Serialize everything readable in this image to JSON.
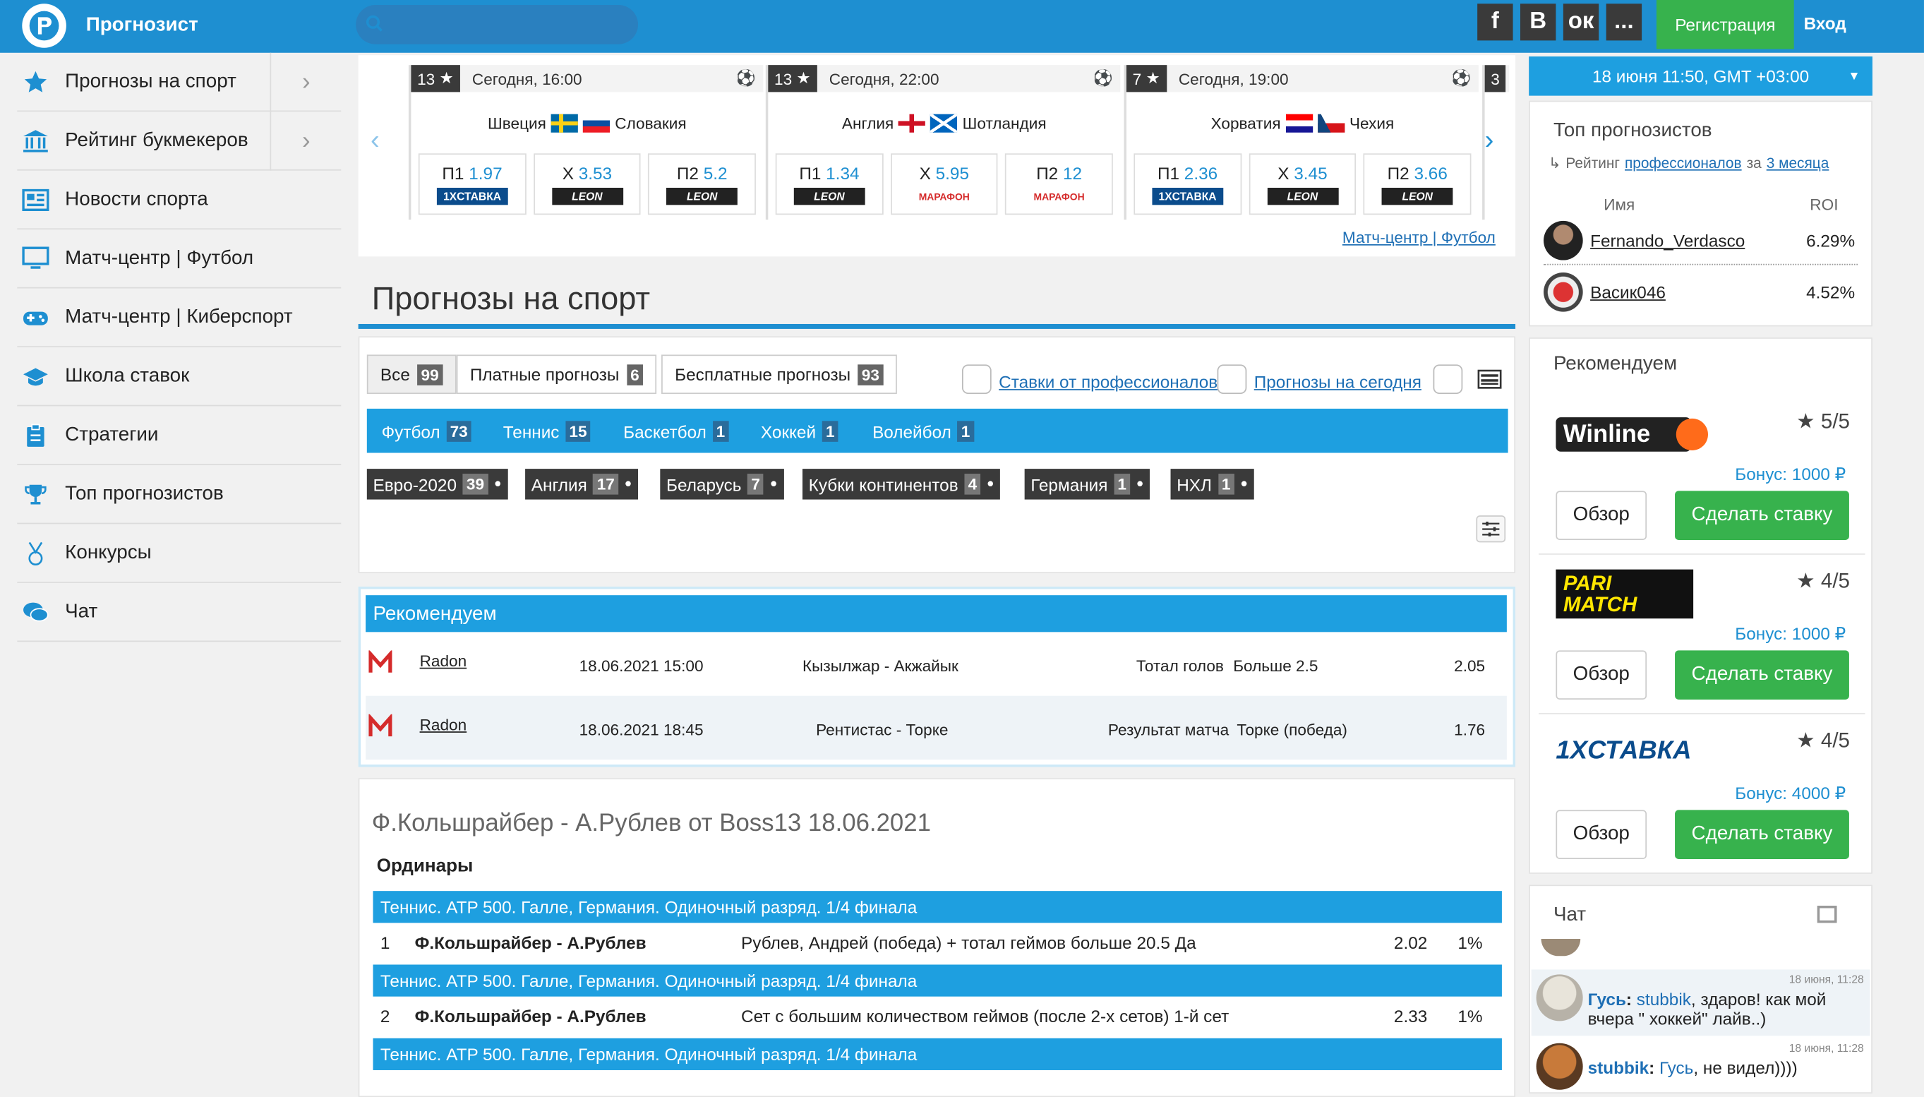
{
  "header": {
    "logo_text": "Прогнозист",
    "search_placeholder": "",
    "social": [
      "f",
      "B",
      "ок",
      "..."
    ],
    "register": "Регистрация",
    "login": "Вход"
  },
  "sidebar": {
    "items": [
      {
        "label": "Прогнозы на спорт",
        "icon": "star-icon",
        "has_chevron": true
      },
      {
        "label": "Рейтинг букмекеров",
        "icon": "bank-icon",
        "has_chevron": true
      },
      {
        "label": "Новости спорта",
        "icon": "newspaper-icon",
        "has_chevron": false
      },
      {
        "label": "Матч-центр | Футбол",
        "icon": "monitor-icon",
        "has_chevron": false
      },
      {
        "label": "Матч-центр | Киберспорт",
        "icon": "gamepad-icon",
        "has_chevron": false
      },
      {
        "label": "Школа ставок",
        "icon": "graduation-cap-icon",
        "has_chevron": false
      },
      {
        "label": "Стратегии",
        "icon": "clipboard-icon",
        "has_chevron": false
      },
      {
        "label": "Топ прогнозистов",
        "icon": "trophy-icon",
        "has_chevron": false
      },
      {
        "label": "Конкурсы",
        "icon": "medal-icon",
        "has_chevron": false
      },
      {
        "label": "Чат",
        "icon": "chat-icon",
        "has_chevron": false
      }
    ]
  },
  "matches": [
    {
      "rating": "13",
      "time": "Сегодня, 16:00",
      "home": "Швеция",
      "away": "Словакия",
      "odds": [
        {
          "k": "П1",
          "v": "1.97",
          "bm": "1XСТАВКА"
        },
        {
          "k": "X",
          "v": "3.53",
          "bm": "LEON"
        },
        {
          "k": "П2",
          "v": "5.2",
          "bm": "LEON"
        }
      ]
    },
    {
      "rating": "13",
      "time": "Сегодня, 22:00",
      "home": "Англия",
      "away": "Шотландия",
      "odds": [
        {
          "k": "П1",
          "v": "1.34",
          "bm": "LEON"
        },
        {
          "k": "X",
          "v": "5.95",
          "bm": "МАРАФОН"
        },
        {
          "k": "П2",
          "v": "12",
          "bm": "МАРАФОН"
        }
      ]
    },
    {
      "rating": "7",
      "time": "Сегодня, 19:00",
      "home": "Хорватия",
      "away": "Чехия",
      "odds": [
        {
          "k": "П1",
          "v": "2.36",
          "bm": "1XСТАВКА"
        },
        {
          "k": "X",
          "v": "3.45",
          "bm": "LEON"
        },
        {
          "k": "П2",
          "v": "3.66",
          "bm": "LEON"
        }
      ]
    },
    {
      "rating": "3"
    }
  ],
  "match_center_link": "Матч-центр | Футбол",
  "page_title": "Прогнозы на спорт",
  "filter_tabs": [
    {
      "label": "Все",
      "count": "99"
    },
    {
      "label": "Платные прогнозы",
      "count": "6"
    },
    {
      "label": "Бесплатные прогнозы",
      "count": "93"
    }
  ],
  "checks": {
    "pros": "Ставки от профессионалов",
    "today": "Прогнозы на сегодня"
  },
  "sports": [
    {
      "label": "Футбол",
      "count": "73"
    },
    {
      "label": "Теннис",
      "count": "15"
    },
    {
      "label": "Баскетбол",
      "count": "1"
    },
    {
      "label": "Хоккей",
      "count": "1"
    },
    {
      "label": "Волейбол",
      "count": "1"
    }
  ],
  "championships": [
    {
      "label": "Евро-2020",
      "count": "39"
    },
    {
      "label": "Англия",
      "count": "17"
    },
    {
      "label": "Беларусь",
      "count": "7"
    },
    {
      "label": "Кубки континентов",
      "count": "4"
    },
    {
      "label": "Германия",
      "count": "1"
    },
    {
      "label": "НХЛ",
      "count": "1"
    }
  ],
  "recommend": {
    "title": "Рекомендуем",
    "rows": [
      {
        "user": "Radon",
        "date": "18.06.2021 15:00",
        "match": "Кызылжар - Акжайык",
        "market": "Тотал голов",
        "pick": "Больше 2.5",
        "odd": "2.05"
      },
      {
        "user": "Radon",
        "date": "18.06.2021 18:45",
        "match": "Рентистас - Торке",
        "market": "Результат матча",
        "pick": "Торке (победа)",
        "odd": "1.76"
      }
    ]
  },
  "forecast": {
    "title": "Ф.Кольшрайбер - А.Рублев от Boss13 18.06.2021",
    "subtitle": "Ординары",
    "rows": [
      {
        "header": "Теннис. ATP 500. Галле, Германия. Одиночный разряд. 1/4 финала",
        "n": "1",
        "match": "Ф.Кольшрайбер - А.Рублев",
        "pick": "Рублев, Андрей (победа) + тотал геймов больше 20.5 Да",
        "odd": "2.02",
        "stake": "1%"
      },
      {
        "header": "Теннис. ATP 500. Галле, Германия. Одиночный разряд. 1/4 финала",
        "n": "2",
        "match": "Ф.Кольшрайбер - А.Рублев",
        "pick": "Сет с большим количеством геймов (после 2-х сетов) 1-й сет",
        "odd": "2.33",
        "stake": "1%"
      },
      {
        "header": "Теннис. ATP 500. Галле, Германия. Одиночный разряд. 1/4 финала"
      }
    ]
  },
  "right": {
    "datetime": "18 июня 11:50, GMT +03:00",
    "top": {
      "title": "Топ прогнозистов",
      "rating_prefix": "Рейтинг",
      "rating_link": "профессионалов",
      "rating_mid": "за",
      "period_link": "3 месяца",
      "col_name": "Имя",
      "col_roi": "ROI",
      "rows": [
        {
          "name": "Fernando_Verdasco",
          "roi": "6.29%"
        },
        {
          "name": "Васик046",
          "roi": "4.52%"
        }
      ]
    },
    "bookmakers": {
      "title": "Рекомендуем",
      "items": [
        {
          "name": "Winline",
          "rating": "5/5",
          "bonus": "Бонус: 1000 ₽",
          "review": "Обзор",
          "bet": "Сделать ставку"
        },
        {
          "name": "PARI MATCH",
          "rating": "4/5",
          "bonus": "Бонус: 1000 ₽",
          "review": "Обзор",
          "bet": "Сделать ставку"
        },
        {
          "name": "1XСТАВКА",
          "rating": "4/5",
          "bonus": "Бонус: 4000 ₽",
          "review": "Обзор",
          "bet": "Сделать ставку"
        }
      ]
    },
    "chat": {
      "title": "Чат",
      "messages": [
        {
          "time": "18 июня, 11:28",
          "author": "Гусь",
          "to": "stubbik",
          "text": ", здаров! как мой вчера \" хоккей\" лайв..)"
        },
        {
          "time": "18 июня, 11:28",
          "author": "stubbik",
          "to": "Гусь",
          "text": ", не видел))))"
        }
      ]
    }
  },
  "colors": {
    "brand_blue": "#1e8fd1",
    "accent_blue": "#1e9fe0",
    "green": "#37b24d"
  }
}
